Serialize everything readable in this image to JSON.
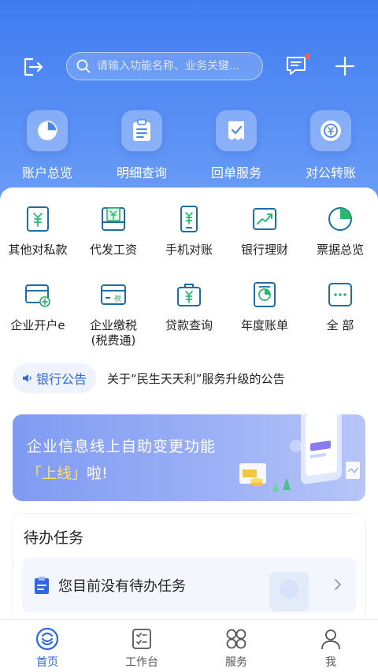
{
  "header": {
    "search_placeholder": "请输入功能名称、业务关键..."
  },
  "quick_actions": [
    {
      "label": "账户总览",
      "icon": "pie-chart-icon"
    },
    {
      "label": "明细查询",
      "icon": "clipboard-list-icon"
    },
    {
      "label": "回单服务",
      "icon": "receipt-check-icon"
    },
    {
      "label": "对公转账",
      "icon": "currency-exchange-icon"
    }
  ],
  "grid": [
    {
      "label": "其他对私款",
      "icon": "yuan-card-icon"
    },
    {
      "label": "代发工资",
      "icon": "salary-icon"
    },
    {
      "label": "手机对账",
      "icon": "mobile-yuan-icon"
    },
    {
      "label": "银行理财",
      "icon": "trend-chart-icon"
    },
    {
      "label": "票据总览",
      "icon": "pie-slice-icon"
    },
    {
      "label": "企业开户e",
      "icon": "account-open-icon"
    },
    {
      "label": "企业缴税\n(税费通)",
      "icon": "tax-card-icon"
    },
    {
      "label": "贷款查询",
      "icon": "loan-bag-icon"
    },
    {
      "label": "年度账单",
      "icon": "annual-bill-icon"
    },
    {
      "label": "全 部",
      "icon": "more-icon"
    }
  ],
  "notice": {
    "badge": "银行公告",
    "text": "关于“民生天天利”服务升级的公告"
  },
  "banner": {
    "title": "企业信息线上自助变更功能",
    "sub_highlight": "「上线」",
    "sub_rest": "啦!"
  },
  "tasks": {
    "title": "待办任务",
    "empty_text": "您目前没有待办任务"
  },
  "tabbar": [
    {
      "label": "首页",
      "icon": "home-logo-icon",
      "active": true
    },
    {
      "label": "工作台",
      "icon": "workbench-icon",
      "active": false
    },
    {
      "label": "服务",
      "icon": "services-icon",
      "active": false
    },
    {
      "label": "我",
      "icon": "profile-icon",
      "active": false
    }
  ],
  "colors": {
    "accent": "#2d68e6",
    "hero": "#4a86f2",
    "badge_dot": "#ff5a4a"
  }
}
